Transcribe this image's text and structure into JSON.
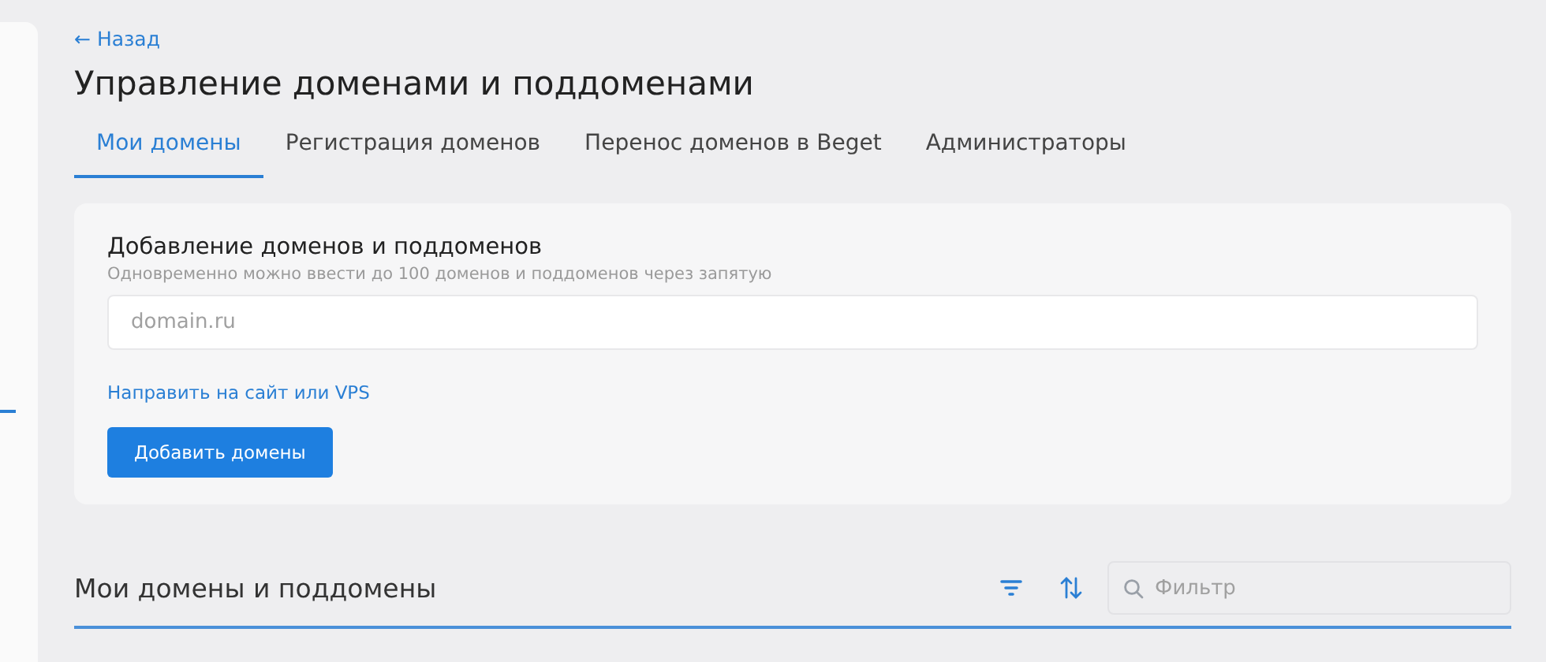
{
  "back_link": "← Назад",
  "title": "Управление доменами и поддоменами",
  "tabs": [
    {
      "label": "Мои домены",
      "selected": true
    },
    {
      "label": "Регистрация доменов",
      "selected": false
    },
    {
      "label": "Перенос доменов в Beget",
      "selected": false
    },
    {
      "label": "Администраторы",
      "selected": false
    }
  ],
  "add_card": {
    "title": "Добавление доменов и поддоменов",
    "hint": "Одновременно можно ввести до 100 доменов и поддоменов через запятую",
    "input": {
      "placeholder": "domain.ru"
    },
    "link": "Направить на сайт или VPS",
    "button": "Добавить домены"
  },
  "list_section": {
    "title": "Мои домены и поддомены",
    "filter": {
      "placeholder": "Фильтр"
    }
  }
}
